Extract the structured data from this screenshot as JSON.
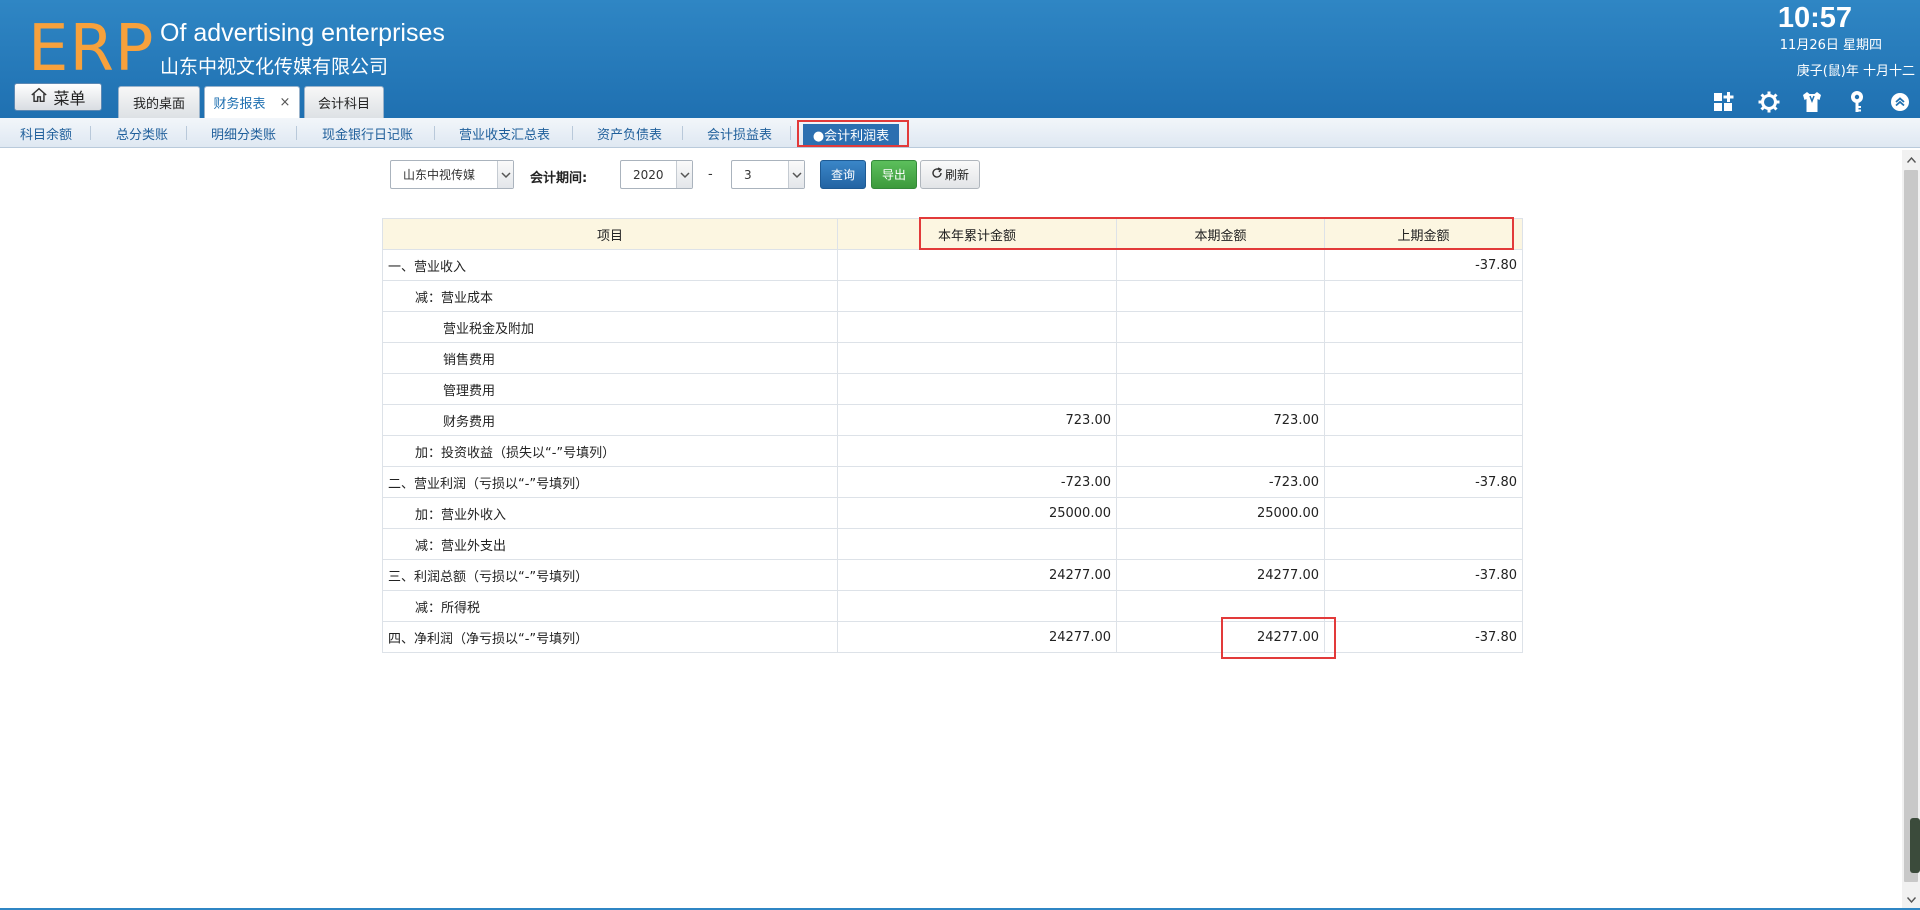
{
  "header": {
    "logo": "ERP",
    "brand_en": "Of advertising enterprises",
    "brand_cn": "山东中视文化传媒有限公司",
    "time": "10:57",
    "date": "11月26日 星期四",
    "lunar": "庚子(鼠)年 十月十二",
    "menu_label": "菜单",
    "tabs": [
      {
        "label": "我的桌面"
      },
      {
        "label": "财务报表",
        "close": "×"
      },
      {
        "label": "会计科目"
      }
    ],
    "icons": [
      "dashboard-add-icon",
      "gear-icon",
      "shirt-icon",
      "key-icon",
      "collapse-up-icon"
    ]
  },
  "subnav": {
    "items": [
      "科目余额",
      "总分类账",
      "明细分类账",
      "现金银行日记账",
      "营业收支汇总表",
      "资产负债表",
      "会计损益表"
    ],
    "active": "●会计利润表"
  },
  "filters": {
    "company": "山东中视传媒",
    "period_label": "会计期间:",
    "year": "2020",
    "separator": "-",
    "month": "3",
    "query_label": "查询",
    "export_label": "导出",
    "refresh_label": "刷新"
  },
  "table": {
    "headers": [
      "项目",
      "本年累计金额",
      "本期金额",
      "上期金额"
    ],
    "rows": [
      {
        "item": "一、营业收入",
        "level": 0,
        "ytd": "",
        "current": "",
        "previous": "-37.80"
      },
      {
        "item": "减：营业成本",
        "level": 1,
        "ytd": "",
        "current": "",
        "previous": ""
      },
      {
        "item": "营业税金及附加",
        "level": 2,
        "ytd": "",
        "current": "",
        "previous": ""
      },
      {
        "item": "销售费用",
        "level": 2,
        "ytd": "",
        "current": "",
        "previous": ""
      },
      {
        "item": "管理费用",
        "level": 2,
        "ytd": "",
        "current": "",
        "previous": ""
      },
      {
        "item": "财务费用",
        "level": 2,
        "ytd": "723.00",
        "current": "723.00",
        "previous": ""
      },
      {
        "item": "加：投资收益（损失以“-”号填列）",
        "level": 1,
        "ytd": "",
        "current": "",
        "previous": ""
      },
      {
        "item": "二、营业利润（亏损以“-”号填列）",
        "level": 0,
        "ytd": "-723.00",
        "current": "-723.00",
        "previous": "-37.80"
      },
      {
        "item": "加：营业外收入",
        "level": 1,
        "ytd": "25000.00",
        "current": "25000.00",
        "previous": ""
      },
      {
        "item": "减：营业外支出",
        "level": 1,
        "ytd": "",
        "current": "",
        "previous": ""
      },
      {
        "item": "三、利润总额（亏损以“-”号填列）",
        "level": 0,
        "ytd": "24277.00",
        "current": "24277.00",
        "previous": "-37.80"
      },
      {
        "item": "减：所得税",
        "level": 1,
        "ytd": "",
        "current": "",
        "previous": ""
      },
      {
        "item": "四、净利润（净亏损以“-”号填列）",
        "level": 0,
        "ytd": "24277.00",
        "current": "24277.00",
        "previous": "-37.80"
      }
    ]
  }
}
